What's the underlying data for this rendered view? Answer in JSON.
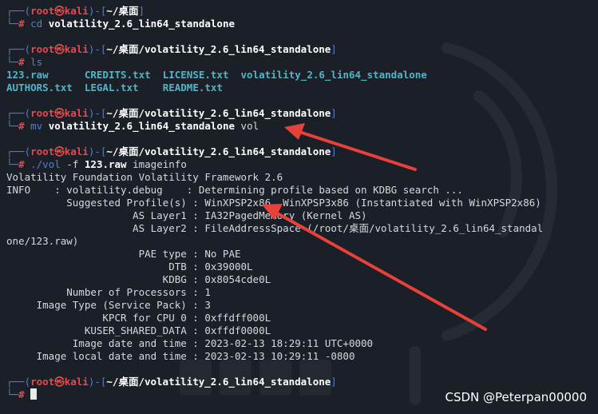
{
  "prompt": {
    "open": "┌──(",
    "user": "root㉿kali",
    "mid": ")-[",
    "close": "]",
    "hash_prefix": "└─",
    "hash": "#"
  },
  "blocks": [
    {
      "path": "~/桌面",
      "command": "cd",
      "args": [
        {
          "text": "volatility_2.6_lin64_standalone",
          "bold": true
        }
      ]
    },
    {
      "path": "~/桌面/volatility_2.6_lin64_standalone",
      "command": "ls",
      "args": []
    },
    {
      "path": "~/桌面/volatility_2.6_lin64_standalone",
      "command": "mv",
      "args": [
        {
          "text": "volatility_2.6_lin64_standalone",
          "bold": true
        },
        {
          "text": "vol",
          "bold": false
        }
      ]
    },
    {
      "path": "~/桌面/volatility_2.6_lin64_standalone",
      "command": "./vol",
      "args": [
        {
          "text": "-f",
          "bold": false
        },
        {
          "text": "123.raw",
          "bold": true
        },
        {
          "text": "imageinfo",
          "bold": false
        }
      ]
    },
    {
      "path": "~/桌面/volatility_2.6_lin64_standalone",
      "command": "",
      "args": []
    }
  ],
  "ls_output": [
    [
      "123.raw",
      "CREDITS.txt",
      "LICENSE.txt",
      "volatility_2.6_lin64_standalone"
    ],
    [
      "AUTHORS.txt",
      "LEGAL.txt",
      "README.txt"
    ]
  ],
  "imageinfo_output": [
    "Volatility Foundation Volatility Framework 2.6",
    "INFO    : volatility.debug    : Determining profile based on KDBG search ...",
    "          Suggested Profile(s) : WinXPSP2x86, WinXPSP3x86 (Instantiated with WinXPSP2x86)",
    "                     AS Layer1 : IA32PagedMemory (Kernel AS)",
    "                     AS Layer2 : FileAddressSpace (/root/桌面/volatility_2.6_lin64_standal",
    "one/123.raw)",
    "                      PAE type : No PAE",
    "                           DTB : 0x39000L",
    "                          KDBG : 0x8054cde0L",
    "          Number of Processors : 1",
    "     Image Type (Service Pack) : 3",
    "                KPCR for CPU 0 : 0xffdff000L",
    "             KUSER_SHARED_DATA : 0xffdf0000L",
    "           Image date and time : 2023-02-13 18:29:11 UTC+0000",
    "     Image local date and time : 2023-02-13 10:29:11 -0800"
  ],
  "watermark": "CSDN @Peterpan00000",
  "colors": {
    "background": "#1b1f27",
    "prompt_frame": "#4f7fd7",
    "prompt_user": "#e5484d",
    "file_listing": "#4db6c9",
    "annotation_arrow": "#e8413a"
  }
}
